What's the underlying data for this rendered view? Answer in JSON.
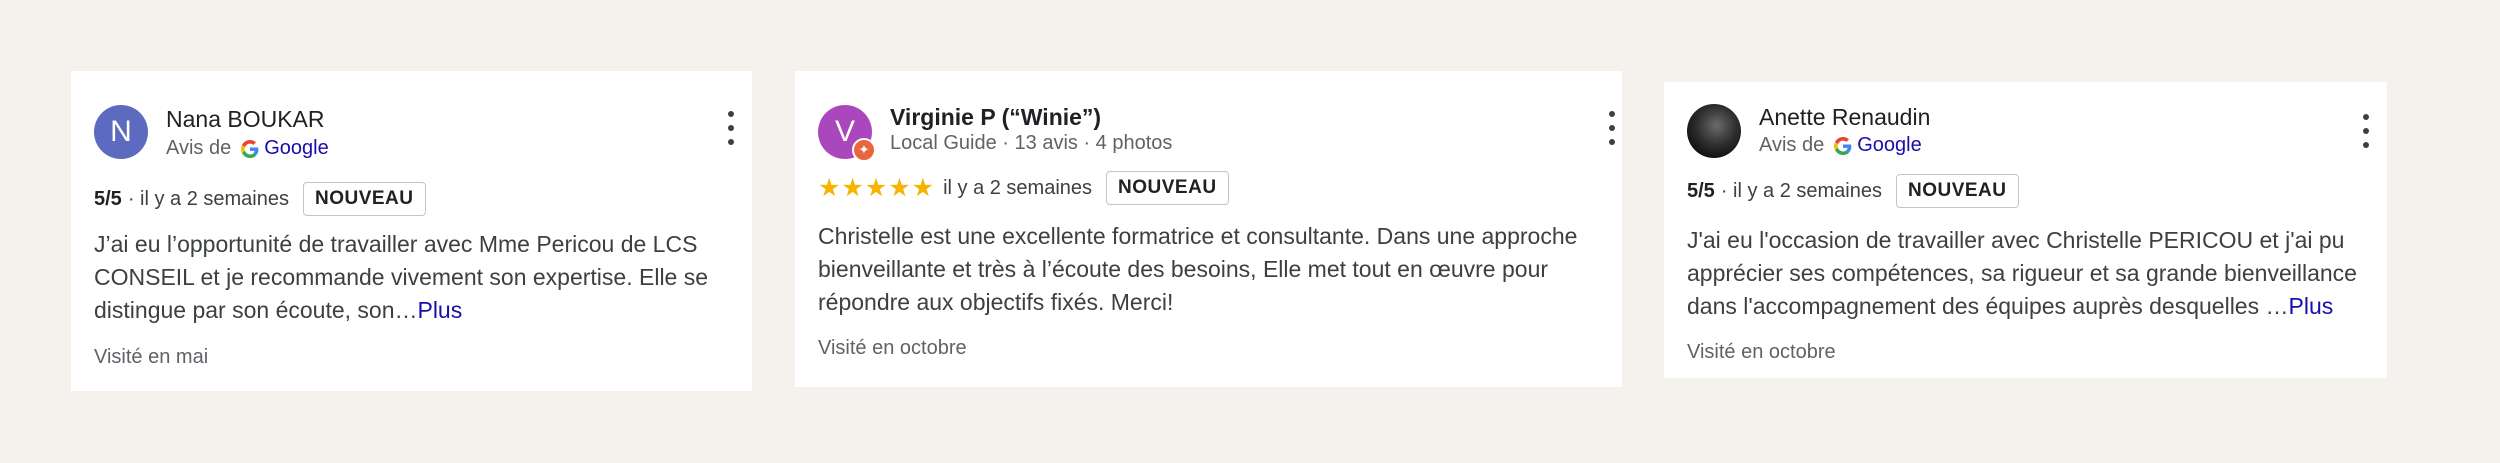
{
  "reviews": [
    {
      "avatar_letter": "N",
      "name": "Nana BOUKAR",
      "source_prefix": "Avis de",
      "source_name": "Google",
      "rating": "5/5",
      "time": "· il y a 2 semaines",
      "badge": "NOUVEAU",
      "text": "J’ai eu l’opportunité de travailler avec Mme Pericou de LCS CONSEIL et je recommande vivement son expertise. Elle se distingue par son écoute, son…",
      "more": "Plus",
      "visited": "Visité en mai"
    },
    {
      "avatar_letter": "V",
      "name": "Virginie P (“Winie”)",
      "subtitle": "Local Guide · 13 avis · 4 photos",
      "stars": "★★★★★",
      "time": "il y a 2 semaines",
      "badge": "NOUVEAU",
      "text": "Christelle est une excellente formatrice et consultante. Dans une approche bienveillante et très à l’écoute des besoins, Elle met tout en œuvre pour répondre aux objectifs fixés. Merci!",
      "visited": "Visité en octobre"
    },
    {
      "name": "Anette Renaudin",
      "source_prefix": "Avis de",
      "source_name": "Google",
      "rating": "5/5",
      "time": "· il y a 2 semaines",
      "badge": "NOUVEAU",
      "text": "J'ai eu l'occasion de travailler avec Christelle PERICOU et j'ai pu apprécier ses compétences, sa rigueur et sa grande bienveillance dans l'accompagnement des équipes auprès desquelles …",
      "more": "Plus",
      "visited": "Visité en octobre"
    }
  ],
  "colors": {
    "background": "#f5f1ec",
    "avatar_n": "#5c6bc0",
    "avatar_v": "#ab47bc",
    "stars": "#f5b400",
    "link": "#1a0dab"
  },
  "icons": {
    "menu": "more-vert-icon",
    "google": "google-g-icon",
    "local_guide": "local-guide-badge-icon"
  }
}
